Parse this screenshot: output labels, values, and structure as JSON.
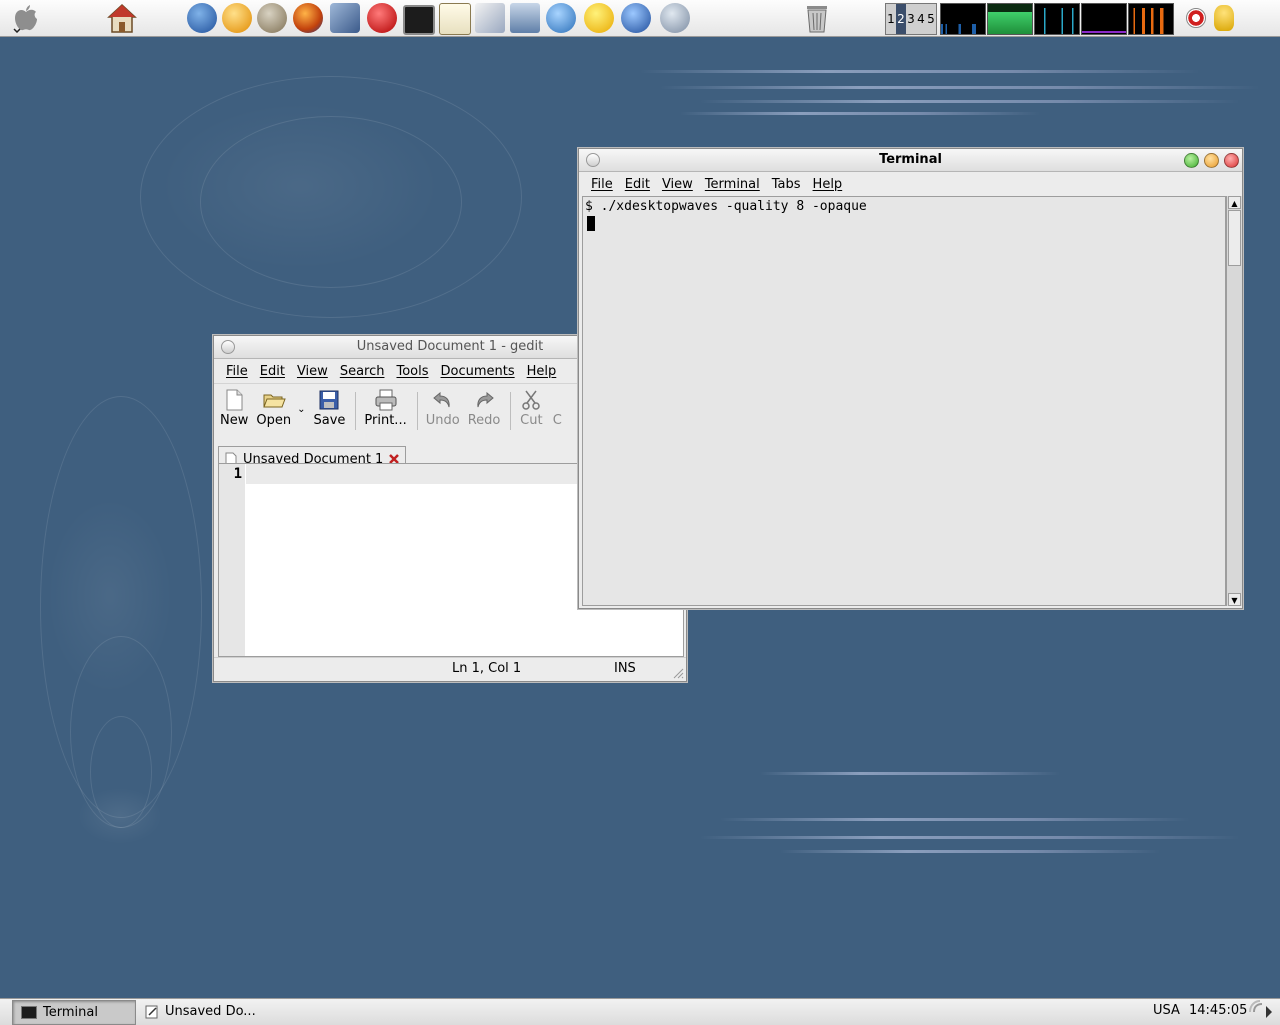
{
  "top_panel": {
    "pager": [
      "1",
      "2",
      "3",
      "4",
      "5"
    ],
    "active_workspace_index": 1
  },
  "gedit": {
    "title": "Unsaved Document 1 - gedit",
    "menu": [
      "File",
      "Edit",
      "View",
      "Search",
      "Tools",
      "Documents",
      "Help"
    ],
    "toolbar": {
      "new": "New",
      "open": "Open",
      "save": "Save",
      "print": "Print...",
      "undo": "Undo",
      "redo": "Redo",
      "cut": "Cut",
      "copy": "C"
    },
    "tab_label": "Unsaved Document 1",
    "line_numbers": [
      "1"
    ],
    "status": {
      "position": "Ln 1, Col 1",
      "mode": "INS"
    }
  },
  "terminal": {
    "title": "Terminal",
    "menu": [
      "File",
      "Edit",
      "View",
      "Terminal",
      "Tabs",
      "Help"
    ],
    "lines": [
      "$ ./xdesktopwaves -quality 8 -opaque"
    ]
  },
  "taskbar": {
    "tasks": [
      "Terminal",
      "Unsaved Do..."
    ],
    "locale": "USA",
    "clock": "14:45:05"
  },
  "colors": {
    "desktop": "#3f5f7f",
    "close": "#d93030",
    "minimize": "#e89a2a",
    "maximize": "#3fae2f",
    "pager_active": "#3b4e6b"
  }
}
